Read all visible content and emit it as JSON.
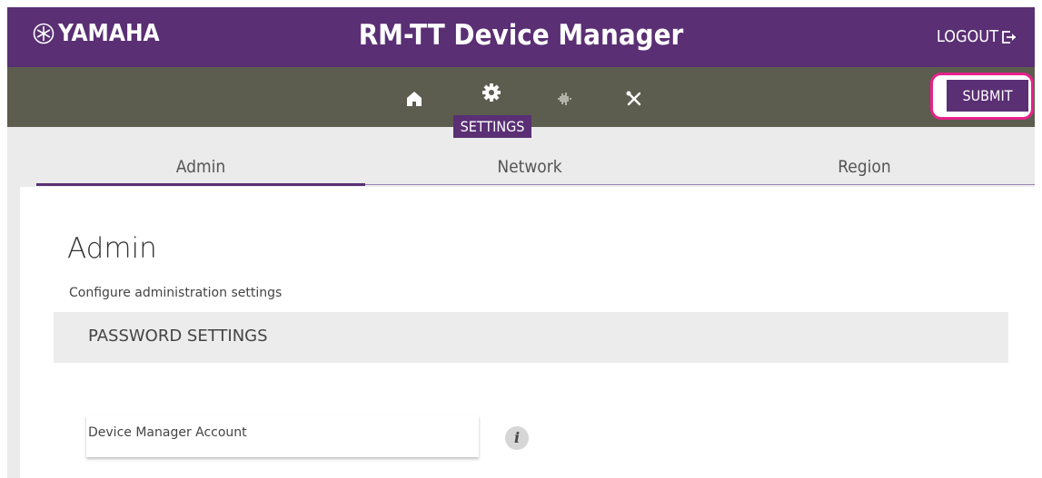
{
  "header": {
    "brand": "YAMAHA",
    "title": "RM-TT Device Manager",
    "logout_label": "LOGOUT"
  },
  "toolbar": {
    "icons": [
      "home-icon",
      "gear-icon",
      "audio-wave-icon",
      "tools-icon"
    ],
    "active_label": "SETTINGS",
    "submit_label": "SUBMIT"
  },
  "tabs": [
    {
      "label": "Admin",
      "active": true
    },
    {
      "label": "Network",
      "active": false
    },
    {
      "label": "Region",
      "active": false
    }
  ],
  "main": {
    "title": "Admin",
    "description": "Configure administration settings",
    "section_title": "PASSWORD SETTINGS",
    "fields": [
      {
        "label": "Device Manager Account",
        "info_icon": "i"
      }
    ]
  },
  "colors": {
    "header_purple": "#5a2f74",
    "toolbar_olive": "#5c5d4e",
    "highlight_pink": "#e8218a"
  }
}
